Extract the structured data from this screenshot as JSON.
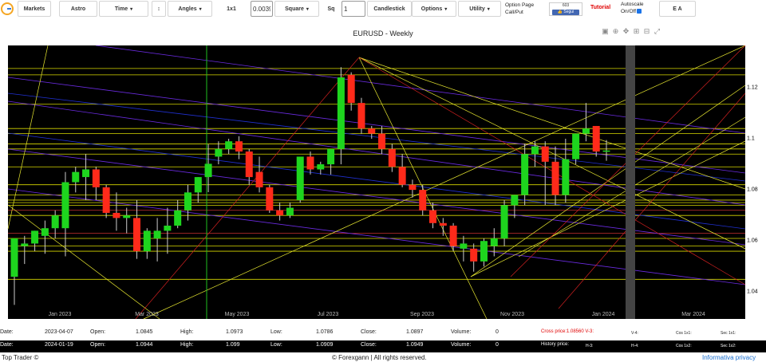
{
  "toolbar": {
    "markets": "Markets",
    "astro": "Astro",
    "time": "Time",
    "arrows": "↕",
    "angles": "Angles",
    "ratio": "1x1",
    "ratio_value": "0.00390",
    "square": "Square",
    "sq": "Sq",
    "sq_value": "1",
    "candlestick": "Candlestick",
    "options": "Options",
    "utility": "Utility",
    "option_page_1": "Option Page",
    "option_page_2": "Call/Put",
    "fb_count": "603",
    "fb_like": "👍 Segui",
    "tutorial": "Tutorial",
    "autoscale_1": "Autoscale",
    "autoscale_2": "On/Off",
    "ea": "E A"
  },
  "chart_title": "EURUSD - Weekly",
  "chart_data": {
    "type": "candlestick",
    "title": "EURUSD - Weekly",
    "x_ticks": [
      "Jan 2023",
      "Mar 2023",
      "May 2023",
      "Jul 2023",
      "Sep 2023",
      "Nov 2023",
      "Jan 2024",
      "Mar 2024"
    ],
    "y_ticks": [
      "1.12",
      "1.1",
      "1.08",
      "1.06",
      "1.04"
    ],
    "ylim": [
      1.029,
      1.136
    ],
    "colors": {
      "up": "#1ed51e",
      "down": "#ff2a1a",
      "background": "#000000"
    },
    "candles": [
      {
        "o": 1.0455,
        "h": 1.0565,
        "l": 1.0345,
        "c": 1.0605
      },
      {
        "o": 1.0575,
        "h": 1.0615,
        "l": 1.0505,
        "c": 1.0585
      },
      {
        "o": 1.0585,
        "h": 1.0635,
        "l": 1.0555,
        "c": 1.0635
      },
      {
        "o": 1.0615,
        "h": 1.0675,
        "l": 1.0545,
        "c": 1.0645
      },
      {
        "o": 1.0645,
        "h": 1.0715,
        "l": 1.0605,
        "c": 1.0695
      },
      {
        "o": 1.0645,
        "h": 1.0865,
        "l": 1.0535,
        "c": 1.0825
      },
      {
        "o": 1.0825,
        "h": 1.0885,
        "l": 1.0785,
        "c": 1.0865
      },
      {
        "o": 1.0845,
        "h": 1.0935,
        "l": 1.0755,
        "c": 1.0875
      },
      {
        "o": 1.0875,
        "h": 1.0885,
        "l": 1.0755,
        "c": 1.0805
      },
      {
        "o": 1.0805,
        "h": 1.0815,
        "l": 1.0685,
        "c": 1.0705
      },
      {
        "o": 1.0705,
        "h": 1.0785,
        "l": 1.0635,
        "c": 1.0685
      },
      {
        "o": 1.0685,
        "h": 1.0725,
        "l": 1.0625,
        "c": 1.0695
      },
      {
        "o": 1.0685,
        "h": 1.0755,
        "l": 1.0525,
        "c": 1.0555
      },
      {
        "o": 1.0555,
        "h": 1.0645,
        "l": 1.0525,
        "c": 1.0635
      },
      {
        "o": 1.0605,
        "h": 1.0685,
        "l": 1.0515,
        "c": 1.0635
      },
      {
        "o": 1.0635,
        "h": 1.0725,
        "l": 1.0545,
        "c": 1.0655
      },
      {
        "o": 1.0655,
        "h": 1.0755,
        "l": 1.0645,
        "c": 1.0715
      },
      {
        "o": 1.0715,
        "h": 1.0815,
        "l": 1.0675,
        "c": 1.0785
      },
      {
        "o": 1.0785,
        "h": 1.0845,
        "l": 1.0745,
        "c": 1.0845
      },
      {
        "o": 1.0845,
        "h": 1.0973,
        "l": 1.0786,
        "c": 1.0897
      },
      {
        "o": 1.0925,
        "h": 1.0985,
        "l": 1.0895,
        "c": 1.0955
      },
      {
        "o": 1.0955,
        "h": 1.0995,
        "l": 1.0935,
        "c": 1.0985
      },
      {
        "o": 1.0985,
        "h": 1.1005,
        "l": 1.0915,
        "c": 1.0945
      },
      {
        "o": 1.0945,
        "h": 1.0955,
        "l": 1.0815,
        "c": 1.0845
      },
      {
        "o": 1.0865,
        "h": 1.0925,
        "l": 1.0785,
        "c": 1.0805
      },
      {
        "o": 1.0805,
        "h": 1.0815,
        "l": 1.0705,
        "c": 1.0715
      },
      {
        "o": 1.0715,
        "h": 1.0745,
        "l": 1.0675,
        "c": 1.0695
      },
      {
        "o": 1.0695,
        "h": 1.0745,
        "l": 1.0685,
        "c": 1.0725
      },
      {
        "o": 1.0755,
        "h": 1.0905,
        "l": 1.0745,
        "c": 1.0925
      },
      {
        "o": 1.0925,
        "h": 1.0945,
        "l": 1.0855,
        "c": 1.0875
      },
      {
        "o": 1.0875,
        "h": 1.0905,
        "l": 1.0855,
        "c": 1.0895
      },
      {
        "o": 1.0895,
        "h": 1.0955,
        "l": 1.0855,
        "c": 1.0955
      },
      {
        "o": 1.0955,
        "h": 1.1275,
        "l": 1.0895,
        "c": 1.1235
      },
      {
        "o": 1.1245,
        "h": 1.1255,
        "l": 1.1105,
        "c": 1.1135
      },
      {
        "o": 1.1135,
        "h": 1.1155,
        "l": 1.1015,
        "c": 1.1035
      },
      {
        "o": 1.1035,
        "h": 1.1045,
        "l": 1.0995,
        "c": 1.1015
      },
      {
        "o": 1.1015,
        "h": 1.1045,
        "l": 1.0935,
        "c": 1.0955
      },
      {
        "o": 1.0955,
        "h": 1.0975,
        "l": 1.0865,
        "c": 1.0885
      },
      {
        "o": 1.0885,
        "h": 1.0935,
        "l": 1.0805,
        "c": 1.0815
      },
      {
        "o": 1.0815,
        "h": 1.0835,
        "l": 1.0765,
        "c": 1.0795
      },
      {
        "o": 1.0795,
        "h": 1.0815,
        "l": 1.0695,
        "c": 1.0715
      },
      {
        "o": 1.0715,
        "h": 1.0745,
        "l": 1.0645,
        "c": 1.0665
      },
      {
        "o": 1.0665,
        "h": 1.0685,
        "l": 1.0615,
        "c": 1.0655
      },
      {
        "o": 1.0655,
        "h": 1.0665,
        "l": 1.0555,
        "c": 1.0575
      },
      {
        "o": 1.0565,
        "h": 1.0615,
        "l": 1.0515,
        "c": 1.0585
      },
      {
        "o": 1.0565,
        "h": 1.0585,
        "l": 1.0475,
        "c": 1.0515
      },
      {
        "o": 1.0515,
        "h": 1.0605,
        "l": 1.0495,
        "c": 1.0595
      },
      {
        "o": 1.0575,
        "h": 1.0645,
        "l": 1.0535,
        "c": 1.0605
      },
      {
        "o": 1.0605,
        "h": 1.0755,
        "l": 1.0575,
        "c": 1.0735
      },
      {
        "o": 1.0735,
        "h": 1.0775,
        "l": 1.0685,
        "c": 1.0775
      },
      {
        "o": 1.0775,
        "h": 1.0975,
        "l": 1.0735,
        "c": 1.0935
      },
      {
        "o": 1.0935,
        "h": 1.0985,
        "l": 1.0885,
        "c": 1.0965
      },
      {
        "o": 1.0965,
        "h": 1.0985,
        "l": 1.0735,
        "c": 1.0905
      },
      {
        "o": 1.0905,
        "h": 1.0965,
        "l": 1.0735,
        "c": 1.0775
      },
      {
        "o": 1.0775,
        "h": 1.0995,
        "l": 1.0745,
        "c": 1.0915
      },
      {
        "o": 1.0915,
        "h": 1.1015,
        "l": 1.0895,
        "c": 1.1015
      },
      {
        "o": 1.1015,
        "h": 1.1135,
        "l": 1.0985,
        "c": 1.1035
      },
      {
        "o": 1.1045,
        "h": 1.1045,
        "l": 1.0925,
        "c": 1.0945
      },
      {
        "o": 1.0944,
        "h": 1.099,
        "l": 1.0909,
        "c": 1.0949
      }
    ]
  },
  "info_row_1": {
    "date_label": "Date:",
    "date": "2023-04-07",
    "open_label": "Open:",
    "open": "1.0845",
    "high_label": "High:",
    "high": "1.0973",
    "low_label": "Low:",
    "low": "1.0786",
    "close_label": "Close:",
    "close": "1.0897",
    "volume_label": "Volume:",
    "volume": "0",
    "cross_price": "Cross price:1.08560 V-3:",
    "v4": "V-4:",
    "cos": "Cos 1x1:",
    "sec": "Sec 1x1:"
  },
  "info_row_2": {
    "date_label": "Date:",
    "date": "2024-01-19",
    "open_label": "Open:",
    "open": "1.0944",
    "high_label": "High:",
    "high": "1.099",
    "low_label": "Low:",
    "low": "1.0909",
    "close_label": "Close:",
    "close": "1.0949",
    "volume_label": "Volume:",
    "volume": "0",
    "history": "History price:",
    "h3": "H-3:",
    "h4": "H-4:",
    "cos": "Cos 1x2:",
    "sec": "Sec 1x2:"
  },
  "footer": {
    "left": "Top Trader ©",
    "center": "© Forexgann | All rights reserved.",
    "right": "Informativa privacy"
  }
}
